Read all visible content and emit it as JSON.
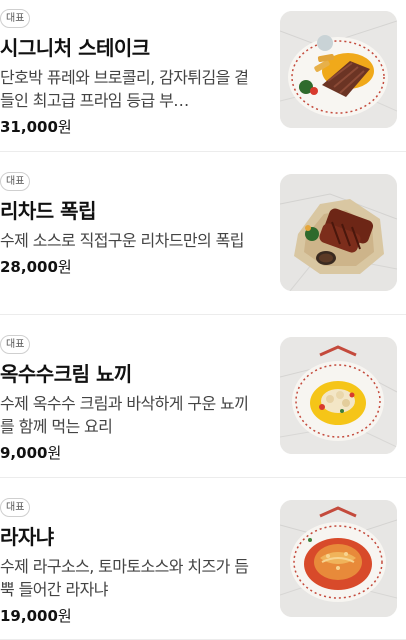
{
  "menu": {
    "items": [
      {
        "badge": "대표",
        "name": "시그니처 스테이크",
        "description": "단호박 퓨레와 브로콜리, 감자튀김을 곁들인 최고급 프라임 등급 부…",
        "price_value": "31,000",
        "price_unit": "원",
        "image_icon": "steak-plate-photo"
      },
      {
        "badge": "대표",
        "name": "리차드 폭립",
        "description": "수제 소스로 직접구운 리차드만의 폭립",
        "price_value": "28,000",
        "price_unit": "원",
        "image_icon": "pork-ribs-photo"
      },
      {
        "badge": "대표",
        "name": "옥수수크림 뇨끼",
        "description": "수제 옥수수 크림과 바삭하게 구운 뇨끼를 함께 먹는 요리",
        "price_value": "9,000",
        "price_unit": "원",
        "image_icon": "gnocchi-bowl-photo"
      },
      {
        "badge": "대표",
        "name": "라자냐",
        "description": "수제 라구소스, 토마토소스와 치즈가 듬뿍 들어간 라자냐",
        "price_value": "19,000",
        "price_unit": "원",
        "image_icon": "lasagna-plate-photo"
      }
    ]
  }
}
